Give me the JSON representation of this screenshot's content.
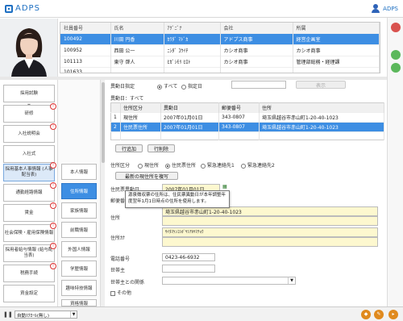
{
  "app": {
    "name": "ADPS",
    "user": "ADPS"
  },
  "employees": {
    "headers": [
      "社員番号",
      "氏名",
      "ｱｸﾞﾆﾞﾅ",
      "会社",
      "所属"
    ],
    "rows": [
      {
        "id": "100492",
        "name": "川田 円香",
        "kana": "ｶﾜﾀﾞ ﾏﾄﾞｶ",
        "company": "アドプス商事",
        "dept": "経営企画室",
        "selected": true
      },
      {
        "id": "100952",
        "name": "西田 公一",
        "kana": "ﾆｼﾀﾞ ｺｳｲﾁ",
        "company": "カシオ商事",
        "dept": "カシオ商事",
        "selected": false
      },
      {
        "id": "101113",
        "name": "東守 啓人",
        "kana": "ﾋｶﾞｼﾓﾘ ﾋﾛﾄ",
        "company": "カシオ商事",
        "dept": "管理部総務・経理課",
        "selected": false
      },
      {
        "id": "101633",
        "name": "",
        "kana": "",
        "company": "",
        "dept": "",
        "selected": false
      }
    ]
  },
  "leftnav": [
    {
      "label": "採用試験",
      "badge": ""
    },
    {
      "label": "研修",
      "badge": "!"
    },
    {
      "label": "入社説明会",
      "badge": "!"
    },
    {
      "label": "入社式",
      "badge": ""
    },
    {
      "label": "採用基本人事情報 (人事配当表)",
      "badge": "!"
    },
    {
      "label": "通勤経路情報",
      "badge": "!"
    },
    {
      "label": "賃金",
      "badge": "!"
    },
    {
      "label": "社会保険・雇用保険情報",
      "badge": "!"
    },
    {
      "label": "採用者給与情報 (給与配当表)",
      "badge": "!"
    },
    {
      "label": "税務手続",
      "badge": "!"
    },
    {
      "label": "資金設定",
      "badge": ""
    },
    {
      "label": "",
      "badge": ""
    }
  ],
  "subnav": [
    "本人情報",
    "住所情報",
    "家族情報",
    "前職情報",
    "外国人情報",
    "学歴情報",
    "趣味特技情報",
    "資格情報"
  ],
  "form": {
    "date_label": "異動日指定",
    "radio_all": "すべて",
    "radio_date": "指定日",
    "search_btn": "表示",
    "period_label": "異動日：すべて",
    "addr_headers": [
      "住所区分",
      "異動日",
      "郵便番号",
      "住所"
    ],
    "addr_rows": [
      {
        "no": "1",
        "type": "現住所",
        "date": "2007年01月01日",
        "zip": "343-0807",
        "addr": "埼玉県越谷市赤山町1-20-40-1023",
        "selected": false
      },
      {
        "no": "2",
        "type": "住民票住所",
        "date": "2007年01月01日",
        "zip": "343-0807",
        "addr": "埼玉県越谷市赤山町1-20-40-1023",
        "selected": true
      }
    ],
    "add_btn": "行追加",
    "del_btn": "行削除",
    "kind_label": "住所区分",
    "kind_options": [
      "現住所",
      "住民票住所",
      "緊急連絡先1",
      "緊急連絡先2"
    ],
    "copy_btn": "最新の現住所を複写",
    "move_date_label": "住民票異動日",
    "move_date": "2007年01月01日",
    "zip_label": "郵便番号",
    "zip": "343-0807",
    "addr_label": "住所",
    "addr": "埼玉県越谷市赤山町1-20-40-1023",
    "addr_kana_label": "住所ｶﾅ",
    "addr_kana": "ｻｲﾀﾏｹﾝｺｼｶﾞﾔｼｱｶﾔﾏﾁｮｳ",
    "tel_label": "電話番号",
    "tel": "0423-46-6932",
    "head_label": "世帯主",
    "relation_label": "世帯主との関係",
    "other_label": "その他",
    "tooltip": "源泉徴収票の住所は、住民票異動日が本年調整年度翌年1月1日時点の住所を使用します。"
  },
  "bottom": {
    "select": "自動ｽｸﾛｰﾙ(無し)"
  }
}
